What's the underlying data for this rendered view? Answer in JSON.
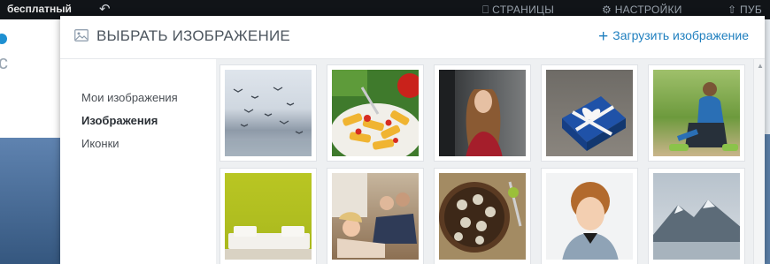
{
  "background": {
    "topbar_free": "бесплатный",
    "topbar_pages": "СТРАНИЦЫ",
    "topbar_settings": "НАСТРОЙКИ",
    "topbar_publish": "ПУБ"
  },
  "modal": {
    "title": "ВЫБРАТЬ ИЗОБРАЖЕНИЕ",
    "upload_label": "Загрузить изображение",
    "sidebar": [
      {
        "label": "Мои изображения",
        "active": false
      },
      {
        "label": "Изображения",
        "active": true
      },
      {
        "label": "Иконки",
        "active": false
      }
    ],
    "images": [
      {
        "subject": "seagulls over water"
      },
      {
        "subject": "pasta with tomatoes"
      },
      {
        "subject": "woman with long hair"
      },
      {
        "subject": "blue gift box with ribbon"
      },
      {
        "subject": "man stretching outdoors"
      },
      {
        "subject": "lime wall with sofa"
      },
      {
        "subject": "family on couch"
      },
      {
        "subject": "stuffed mushrooms"
      },
      {
        "subject": "curly-haired boy"
      },
      {
        "subject": "mountain landscape"
      }
    ]
  },
  "colors": {
    "accent": "#1f7fbf",
    "title": "#4c555e",
    "grid_bg": "#eef0f2"
  }
}
